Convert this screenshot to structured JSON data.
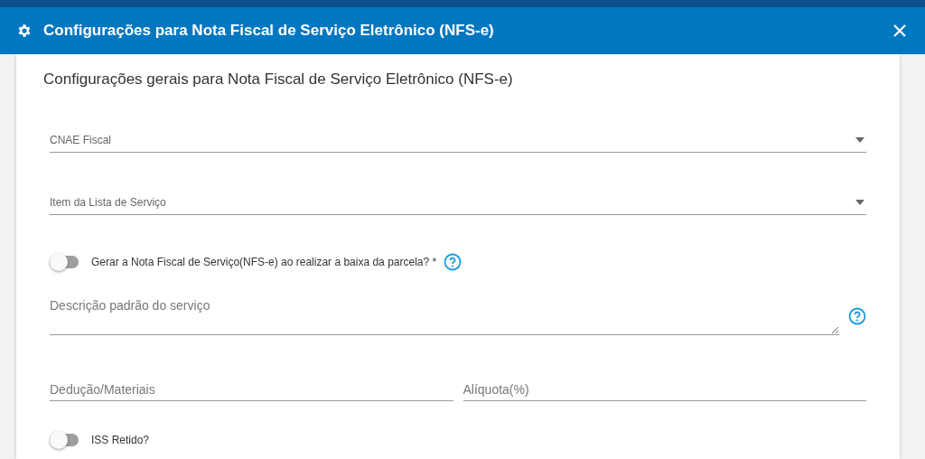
{
  "dialog": {
    "title": "Configurações para Nota Fiscal de Serviço Eletrônico (NFS-e)"
  },
  "section_title": "Configurações gerais para Nota Fiscal de Serviço Eletrônico (NFS-e)",
  "fields": [
    {
      "kind": "select",
      "label": "CNAE Fiscal"
    },
    {
      "kind": "select",
      "label": "Item da Lista de Serviço"
    },
    {
      "kind": "toggle",
      "label": "Gerar a Nota Fiscal de Serviço(NFS-e) ao realizar a baixa da parcela? *",
      "on": false,
      "help": true
    },
    {
      "kind": "textarea",
      "placeholder": "Descrição padrão do serviço",
      "help": true
    },
    {
      "kind": "pair",
      "items": [
        {
          "placeholder": "Dedução/Materiais"
        },
        {
          "placeholder": "Alíquota(%)"
        }
      ]
    },
    {
      "kind": "toggle",
      "label": "ISS Retido?",
      "on": false,
      "help": false
    }
  ]
}
